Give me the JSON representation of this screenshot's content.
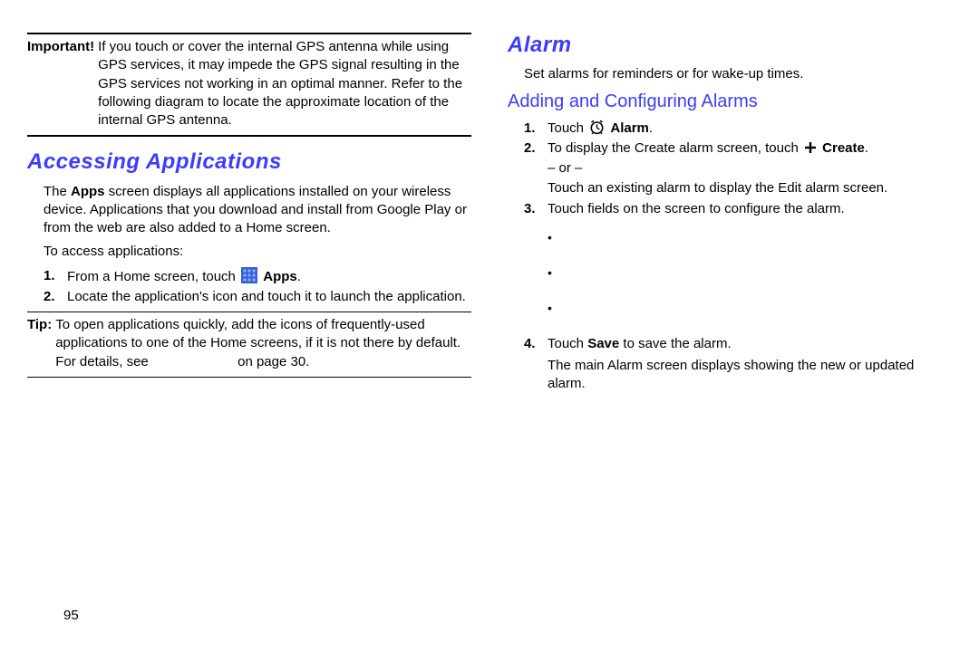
{
  "left": {
    "important_label": "Important!",
    "important_text": "If you touch or cover the internal GPS antenna while using GPS services, it may impede the GPS signal resulting in the GPS services not working in an optimal manner. Refer to the following diagram to locate the approximate location of the internal GPS antenna.",
    "heading": "Accessing Applications",
    "apps_intro_before": "The ",
    "apps_intro_bold": "Apps",
    "apps_intro_after": " screen displays all applications installed on your wireless device. Applications that you download and install from Google Play or from the web are also added to a Home screen.",
    "access_label": "To access applications:",
    "step1_before": "From a Home screen, touch ",
    "step1_bold": "Apps",
    "step1_after": ".",
    "step2": "Locate the application's icon and touch it to launch the application.",
    "tip_label": "Tip:",
    "tip_text_before": "To open applications quickly, add the icons of frequently-used applications to one of the Home screens, if it is not there by default. For details, see ",
    "tip_text_after": " on page 30."
  },
  "right": {
    "heading": "Alarm",
    "intro": "Set alarms for reminders or for wake-up times.",
    "subheading": "Adding and Configuring Alarms",
    "step1_before": "Touch ",
    "step1_bold": "Alarm",
    "step1_after": ".",
    "step2_before": "To display the Create alarm screen, touch ",
    "step2_bold": "Create",
    "step2_after": ".",
    "step2_or": "– or –",
    "step2_second": "Touch an existing alarm to display the Edit alarm screen.",
    "step3": "Touch fields on the screen to configure the alarm.",
    "step4_before": "Touch ",
    "step4_bold": "Save",
    "step4_after": " to save the alarm.",
    "step4_second": "The main Alarm screen displays showing the new or updated alarm."
  },
  "page_number": "95"
}
